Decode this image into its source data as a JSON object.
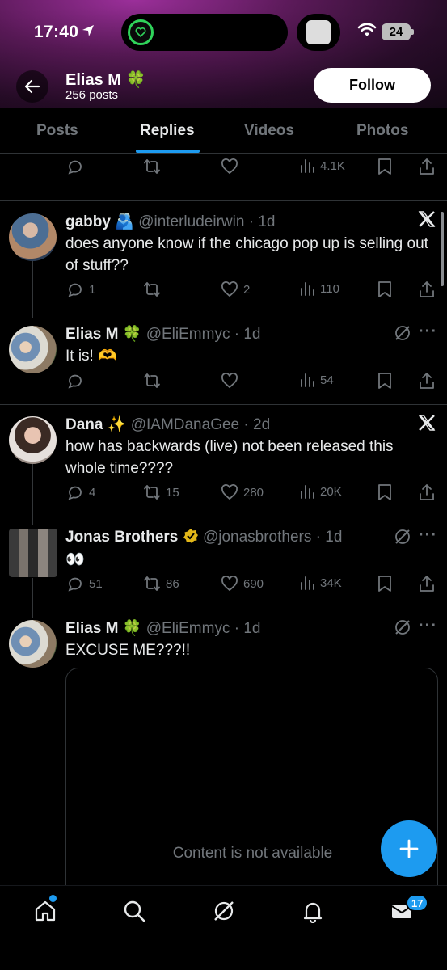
{
  "status_bar": {
    "time": "17:40",
    "battery": "24"
  },
  "profile": {
    "name": "Elias M",
    "name_emoji": "🍀",
    "posts_count": "256 posts",
    "follow_label": "Follow"
  },
  "tabs": [
    {
      "label": "Posts",
      "active": false
    },
    {
      "label": "Replies",
      "active": true
    },
    {
      "label": "Videos",
      "active": false
    },
    {
      "label": "Photos",
      "active": false
    }
  ],
  "top_partial": {
    "views": "4.1K"
  },
  "tweets": [
    {
      "name": "gabby",
      "emoji": "🫂",
      "handle": "@interludeirwin",
      "time": "· 1d",
      "text": "does anyone know if the chicago pop up is selling out of stuff??",
      "replies": "1",
      "reposts": "",
      "likes": "2",
      "views": "110"
    },
    {
      "name": "Elias M",
      "emoji": "🍀",
      "handle": "@EliEmmyc",
      "time": "· 1d",
      "text": "It is! 🫶",
      "replies": "",
      "reposts": "",
      "likes": "",
      "views": "54"
    },
    {
      "name": "Dana",
      "emoji": "✨",
      "handle": "@IAMDanaGee",
      "time": "· 2d",
      "text": "how has backwards (live) not been released this whole time????",
      "replies": "4",
      "reposts": "15",
      "likes": "280",
      "views": "20K"
    },
    {
      "name": "Jonas Brothers",
      "emoji": "",
      "handle": "@jonasbrothers",
      "time": "· 1d",
      "text": "👀",
      "replies": "51",
      "reposts": "86",
      "likes": "690",
      "views": "34K"
    },
    {
      "name": "Elias M",
      "emoji": "🍀",
      "handle": "@EliEmmyc",
      "time": "· 1d",
      "text": "EXCUSE ME???!!",
      "card_text": "Content is not available"
    }
  ],
  "bottom_nav": {
    "messages_badge": "17"
  },
  "colors": {
    "accent": "#1d9bf0",
    "muted": "#71767b",
    "divider": "#2f3336",
    "verified_gold": "#e2b719"
  }
}
